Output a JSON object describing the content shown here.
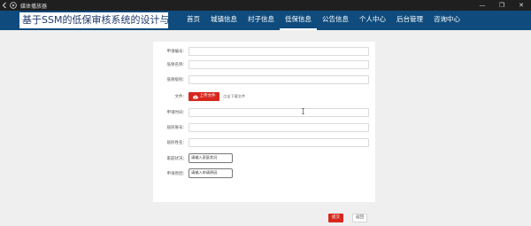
{
  "window": {
    "title": "媒体播放器",
    "controls": {
      "minimize": "—",
      "restore": "❐",
      "close": "✕"
    }
  },
  "site": {
    "brand": "基于SSM的低保审核系统的设计与实现",
    "nav": [
      {
        "label": "首页",
        "active": false
      },
      {
        "label": "城镇信息",
        "active": false
      },
      {
        "label": "村子信息",
        "active": false
      },
      {
        "label": "低保信息",
        "active": true
      },
      {
        "label": "公告信息",
        "active": false
      },
      {
        "label": "个人中心",
        "active": false
      },
      {
        "label": "后台管理",
        "active": false
      },
      {
        "label": "咨询中心",
        "active": false
      }
    ]
  },
  "form": {
    "fields": [
      {
        "label": "申请编号：",
        "value": ""
      },
      {
        "label": "低保名称：",
        "value": ""
      },
      {
        "label": "低保级别：",
        "value": ""
      },
      {
        "label": "文件：",
        "type": "upload"
      },
      {
        "label": "申请时间：",
        "value": ""
      },
      {
        "label": "居民账号：",
        "value": ""
      },
      {
        "label": "居民姓名：",
        "value": ""
      },
      {
        "label": "家庭状况：",
        "placeholder": "请输入家庭状况"
      },
      {
        "label": "申请原因：",
        "placeholder": "请输入申请原因"
      }
    ],
    "upload": {
      "button_label": "上传文件",
      "hint": "点击下载文件"
    },
    "submit_label": "提交",
    "back_label": "返回"
  },
  "colors": {
    "header": "#0f4c7d",
    "accent": "#d7281d",
    "background": "#efefef"
  }
}
